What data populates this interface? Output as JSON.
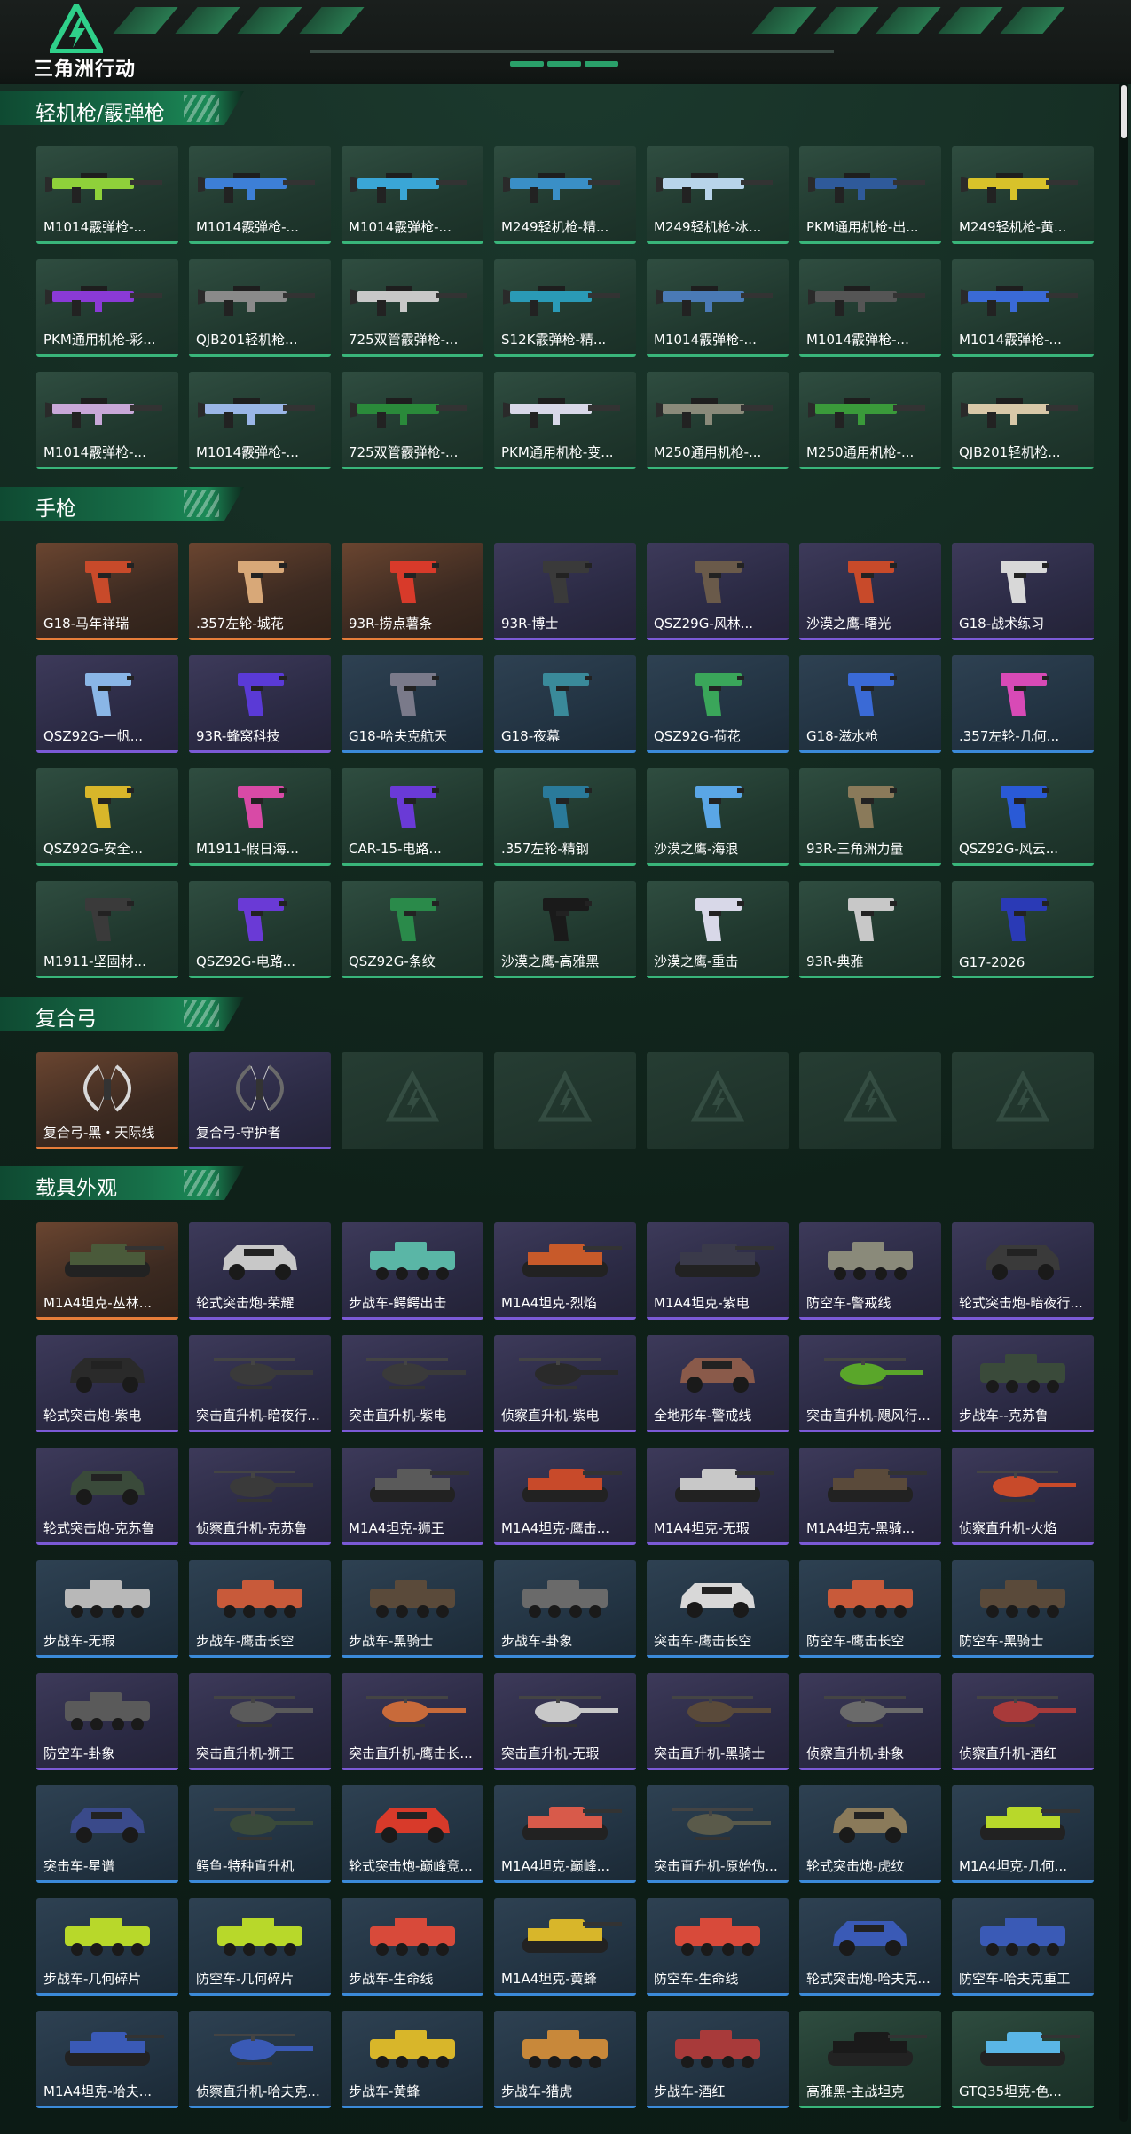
{
  "header": {
    "logo_text": "三角洲行动"
  },
  "sections": [
    {
      "title": "轻机枪/霰弹枪",
      "kind": "gun",
      "items": [
        {
          "name": "M1014霰弹枪-...",
          "rarity": "green",
          "color": "#8fd13a"
        },
        {
          "name": "M1014霰弹枪-...",
          "rarity": "green",
          "color": "#3d7fd6"
        },
        {
          "name": "M1014霰弹枪-...",
          "rarity": "green",
          "color": "#3aa6d6"
        },
        {
          "name": "M249轻机枪-精...",
          "rarity": "green",
          "color": "#3a8fc6"
        },
        {
          "name": "M249轻机枪-冰...",
          "rarity": "green",
          "color": "#b8d4ea"
        },
        {
          "name": "PKM通用机枪-出...",
          "rarity": "green",
          "color": "#2f5a9a"
        },
        {
          "name": "M249轻机枪-黄...",
          "rarity": "green",
          "color": "#d8c22a"
        },
        {
          "name": "PKM通用机枪-彩...",
          "rarity": "green",
          "color": "#8a3ad6"
        },
        {
          "name": "QJB201轻机枪...",
          "rarity": "green",
          "color": "#8a8a8a"
        },
        {
          "name": "725双管霰弹枪-...",
          "rarity": "green",
          "color": "#c8c8c8"
        },
        {
          "name": "S12K霰弹枪-精...",
          "rarity": "green",
          "color": "#2a9ab6"
        },
        {
          "name": "M1014霰弹枪-...",
          "rarity": "green",
          "color": "#4a7ab6"
        },
        {
          "name": "M1014霰弹枪-...",
          "rarity": "green",
          "color": "#555555"
        },
        {
          "name": "M1014霰弹枪-...",
          "rarity": "green",
          "color": "#3a6ad6"
        },
        {
          "name": "M1014霰弹枪-...",
          "rarity": "green",
          "color": "#c8a8d8"
        },
        {
          "name": "M1014霰弹枪-...",
          "rarity": "green",
          "color": "#9ab6e6"
        },
        {
          "name": "725双管霰弹枪-...",
          "rarity": "green",
          "color": "#2a8a3a"
        },
        {
          "name": "PKM通用机枪-变...",
          "rarity": "green",
          "color": "#d8d8e8"
        },
        {
          "name": "M250通用机枪-...",
          "rarity": "green",
          "color": "#8a8a7a"
        },
        {
          "name": "M250通用机枪-...",
          "rarity": "green",
          "color": "#3a9a3a"
        },
        {
          "name": "QJB201轻机枪...",
          "rarity": "green",
          "color": "#d8c8a8"
        }
      ]
    },
    {
      "title": "手枪",
      "kind": "pistol",
      "items": [
        {
          "name": "G18-马年祥瑞",
          "rarity": "gold",
          "color": "#c84a2a"
        },
        {
          "name": ".357左轮-城花",
          "rarity": "gold",
          "color": "#d8a878"
        },
        {
          "name": "93R-捞点薯条",
          "rarity": "gold",
          "color": "#d83a2a"
        },
        {
          "name": "93R-博士",
          "rarity": "purple",
          "color": "#3a3a3a"
        },
        {
          "name": "QSZ29G-风林...",
          "rarity": "purple",
          "color": "#6a5a4a"
        },
        {
          "name": "沙漠之鹰-曙光",
          "rarity": "purple",
          "color": "#c84a2a"
        },
        {
          "name": "G18-战术练习",
          "rarity": "purple",
          "color": "#d8d8d8"
        },
        {
          "name": "QSZ92G-一帆...",
          "rarity": "purple",
          "color": "#8ab6e6"
        },
        {
          "name": "93R-蜂窝科技",
          "rarity": "purple",
          "color": "#5a3ad6"
        },
        {
          "name": "G18-哈夫克航天",
          "rarity": "blue",
          "color": "#7a7a8a"
        },
        {
          "name": "G18-夜幕",
          "rarity": "blue",
          "color": "#3a8a9a"
        },
        {
          "name": "QSZ92G-荷花",
          "rarity": "blue",
          "color": "#3aa65a"
        },
        {
          "name": "G18-滋水枪",
          "rarity": "blue",
          "color": "#3a6ad6"
        },
        {
          "name": ".357左轮-几何...",
          "rarity": "blue",
          "color": "#d84ab6"
        },
        {
          "name": "QSZ92G-安全...",
          "rarity": "green",
          "color": "#d8b62a"
        },
        {
          "name": "M1911-假日海...",
          "rarity": "green",
          "color": "#d84aa6"
        },
        {
          "name": "CAR-15-电路...",
          "rarity": "green",
          "color": "#6a3ad6"
        },
        {
          "name": ".357左轮-精钢",
          "rarity": "green",
          "color": "#2a7a9a"
        },
        {
          "name": "沙漠之鹰-海浪",
          "rarity": "green",
          "color": "#5aa6e6"
        },
        {
          "name": "93R-三角洲力量",
          "rarity": "green",
          "color": "#8a7a5a"
        },
        {
          "name": "QSZ92G-风云...",
          "rarity": "green",
          "color": "#2a5ad6"
        },
        {
          "name": "M1911-坚固材...",
          "rarity": "green",
          "color": "#3a3a3a"
        },
        {
          "name": "QSZ92G-电路...",
          "rarity": "green",
          "color": "#6a3ad6"
        },
        {
          "name": "QSZ92G-条纹",
          "rarity": "green",
          "color": "#2a8a4a"
        },
        {
          "name": "沙漠之鹰-高雅黑",
          "rarity": "green",
          "color": "#1a1a1a"
        },
        {
          "name": "沙漠之鹰-重击",
          "rarity": "green",
          "color": "#d8d8e8"
        },
        {
          "name": "93R-典雅",
          "rarity": "green",
          "color": "#c8c8c8"
        },
        {
          "name": "G17-2026",
          "rarity": "green",
          "color": "#2a3ab6"
        }
      ]
    },
    {
      "title": "复合弓",
      "kind": "bow",
      "items": [
        {
          "name": "复合弓-黑・天际线",
          "rarity": "gold",
          "color": "#d8d8d8"
        },
        {
          "name": "复合弓-守护者",
          "rarity": "purple",
          "color": "#6a6a6a"
        },
        {
          "name": "",
          "rarity": "empty",
          "color": ""
        },
        {
          "name": "",
          "rarity": "empty",
          "color": ""
        },
        {
          "name": "",
          "rarity": "empty",
          "color": ""
        },
        {
          "name": "",
          "rarity": "empty",
          "color": ""
        },
        {
          "name": "",
          "rarity": "empty",
          "color": ""
        }
      ]
    },
    {
      "title": "载具外观",
      "kind": "vehicle",
      "items": [
        {
          "name": "M1A4坦克-丛林...",
          "rarity": "gold",
          "color": "#4a5a3a",
          "type": "tank"
        },
        {
          "name": "轮式突击炮-荣耀",
          "rarity": "purple",
          "color": "#c8c8c8",
          "type": "car"
        },
        {
          "name": "步战车-鳄鳄出击",
          "rarity": "purple",
          "color": "#5ab6a6",
          "type": "apc"
        },
        {
          "name": "M1A4坦克-烈焰",
          "rarity": "purple",
          "color": "#c85a2a",
          "type": "tank"
        },
        {
          "name": "M1A4坦克-紫电",
          "rarity": "purple",
          "color": "#3a3a4a",
          "type": "tank"
        },
        {
          "name": "防空车-警戒线",
          "rarity": "purple",
          "color": "#8a8a7a",
          "type": "apc"
        },
        {
          "name": "轮式突击炮-暗夜行...",
          "rarity": "purple",
          "color": "#3a3a3a",
          "type": "car"
        },
        {
          "name": "轮式突击炮-紫电",
          "rarity": "purple",
          "color": "#2a2a2a",
          "type": "car"
        },
        {
          "name": "突击直升机-暗夜行...",
          "rarity": "purple",
          "color": "#3a3a3a",
          "type": "heli"
        },
        {
          "name": "突击直升机-紫电",
          "rarity": "purple",
          "color": "#3a3a3a",
          "type": "heli"
        },
        {
          "name": "侦察直升机-紫电",
          "rarity": "purple",
          "color": "#2a2a2a",
          "type": "heli"
        },
        {
          "name": "全地形车-警戒线",
          "rarity": "purple",
          "color": "#8a5a4a",
          "type": "car"
        },
        {
          "name": "突击直升机-飓风行...",
          "rarity": "purple",
          "color": "#5aa62a",
          "type": "heli"
        },
        {
          "name": "步战车--克苏鲁",
          "rarity": "purple",
          "color": "#3a4a3a",
          "type": "apc"
        },
        {
          "name": "轮式突击炮-克苏鲁",
          "rarity": "purple",
          "color": "#3a4a3a",
          "type": "car"
        },
        {
          "name": "侦察直升机-克苏鲁",
          "rarity": "purple",
          "color": "#3a3a3a",
          "type": "heli"
        },
        {
          "name": "M1A4坦克-狮王",
          "rarity": "purple",
          "color": "#5a5a5a",
          "type": "tank"
        },
        {
          "name": "M1A4坦克-鹰击...",
          "rarity": "purple",
          "color": "#c84a2a",
          "type": "tank"
        },
        {
          "name": "M1A4坦克-无瑕",
          "rarity": "purple",
          "color": "#c8c8c8",
          "type": "tank"
        },
        {
          "name": "M1A4坦克-黑骑...",
          "rarity": "purple",
          "color": "#5a4a3a",
          "type": "tank"
        },
        {
          "name": "侦察直升机-火焰",
          "rarity": "purple",
          "color": "#c84a2a",
          "type": "heli"
        },
        {
          "name": "步战车-无瑕",
          "rarity": "blue",
          "color": "#b8b8b8",
          "type": "apc"
        },
        {
          "name": "步战车-鹰击长空",
          "rarity": "blue",
          "color": "#c85a3a",
          "type": "apc"
        },
        {
          "name": "步战车-黑骑士",
          "rarity": "blue",
          "color": "#5a4a3a",
          "type": "apc"
        },
        {
          "name": "步战车-卦象",
          "rarity": "blue",
          "color": "#6a6a6a",
          "type": "apc"
        },
        {
          "name": "突击车-鹰击长空",
          "rarity": "blue",
          "color": "#d8d8d8",
          "type": "car"
        },
        {
          "name": "防空车-鹰击长空",
          "rarity": "blue",
          "color": "#c85a3a",
          "type": "apc"
        },
        {
          "name": "防空车-黑骑士",
          "rarity": "blue",
          "color": "#5a4a3a",
          "type": "apc"
        },
        {
          "name": "防空车-卦象",
          "rarity": "purple",
          "color": "#5a5a5a",
          "type": "apc"
        },
        {
          "name": "突击直升机-狮王",
          "rarity": "purple",
          "color": "#5a5a5a",
          "type": "heli"
        },
        {
          "name": "突击直升机-鹰击长...",
          "rarity": "purple",
          "color": "#c86a3a",
          "type": "heli"
        },
        {
          "name": "突击直升机-无瑕",
          "rarity": "purple",
          "color": "#c8c8c8",
          "type": "heli"
        },
        {
          "name": "突击直升机-黑骑士",
          "rarity": "purple",
          "color": "#5a4a3a",
          "type": "heli"
        },
        {
          "name": "侦察直升机-卦象",
          "rarity": "purple",
          "color": "#6a6a6a",
          "type": "heli"
        },
        {
          "name": "侦察直升机-酒红",
          "rarity": "purple",
          "color": "#a83a3a",
          "type": "heli"
        },
        {
          "name": "突击车-星谱",
          "rarity": "blue",
          "color": "#3a4a8a",
          "type": "car"
        },
        {
          "name": "鳄鱼-特种直升机",
          "rarity": "blue",
          "color": "#3a4a3a",
          "type": "heli"
        },
        {
          "name": "轮式突击炮-巅峰竞...",
          "rarity": "blue",
          "color": "#d83a2a",
          "type": "car"
        },
        {
          "name": "M1A4坦克-巅峰...",
          "rarity": "blue",
          "color": "#d85a4a",
          "type": "tank"
        },
        {
          "name": "突击直升机-原始伪...",
          "rarity": "blue",
          "color": "#5a5a4a",
          "type": "heli"
        },
        {
          "name": "轮式突击炮-虎纹",
          "rarity": "blue",
          "color": "#8a7a5a",
          "type": "car"
        },
        {
          "name": "M1A4坦克-几何...",
          "rarity": "blue",
          "color": "#b8d82a",
          "type": "tank"
        },
        {
          "name": "步战车-几何碎片",
          "rarity": "blue",
          "color": "#b8d82a",
          "type": "apc"
        },
        {
          "name": "防空车-几何碎片",
          "rarity": "blue",
          "color": "#b8d82a",
          "type": "apc"
        },
        {
          "name": "步战车-生命线",
          "rarity": "blue",
          "color": "#d84a3a",
          "type": "apc"
        },
        {
          "name": "M1A4坦克-黄蜂",
          "rarity": "blue",
          "color": "#d8b62a",
          "type": "tank"
        },
        {
          "name": "防空车-生命线",
          "rarity": "blue",
          "color": "#d84a3a",
          "type": "apc"
        },
        {
          "name": "轮式突击炮-哈夫克...",
          "rarity": "blue",
          "color": "#3a5ab6",
          "type": "car"
        },
        {
          "name": "防空车-哈夫克重工",
          "rarity": "blue",
          "color": "#3a5ab6",
          "type": "apc"
        },
        {
          "name": "M1A4坦克-哈夫...",
          "rarity": "blue",
          "color": "#3a5ab6",
          "type": "tank"
        },
        {
          "name": "侦察直升机-哈夫克...",
          "rarity": "blue",
          "color": "#3a5ab6",
          "type": "heli"
        },
        {
          "name": "步战车-黄蜂",
          "rarity": "blue",
          "color": "#d8b62a",
          "type": "apc"
        },
        {
          "name": "步战车-猎虎",
          "rarity": "blue",
          "color": "#c8883a",
          "type": "apc"
        },
        {
          "name": "步战车-酒红",
          "rarity": "blue",
          "color": "#a83a3a",
          "type": "apc"
        },
        {
          "name": "高雅黑-主战坦克",
          "rarity": "green",
          "color": "#1a1a1a",
          "type": "tank"
        },
        {
          "name": "GTQ35坦克-色...",
          "rarity": "green",
          "color": "#5ab6e6",
          "type": "tank"
        }
      ]
    }
  ]
}
